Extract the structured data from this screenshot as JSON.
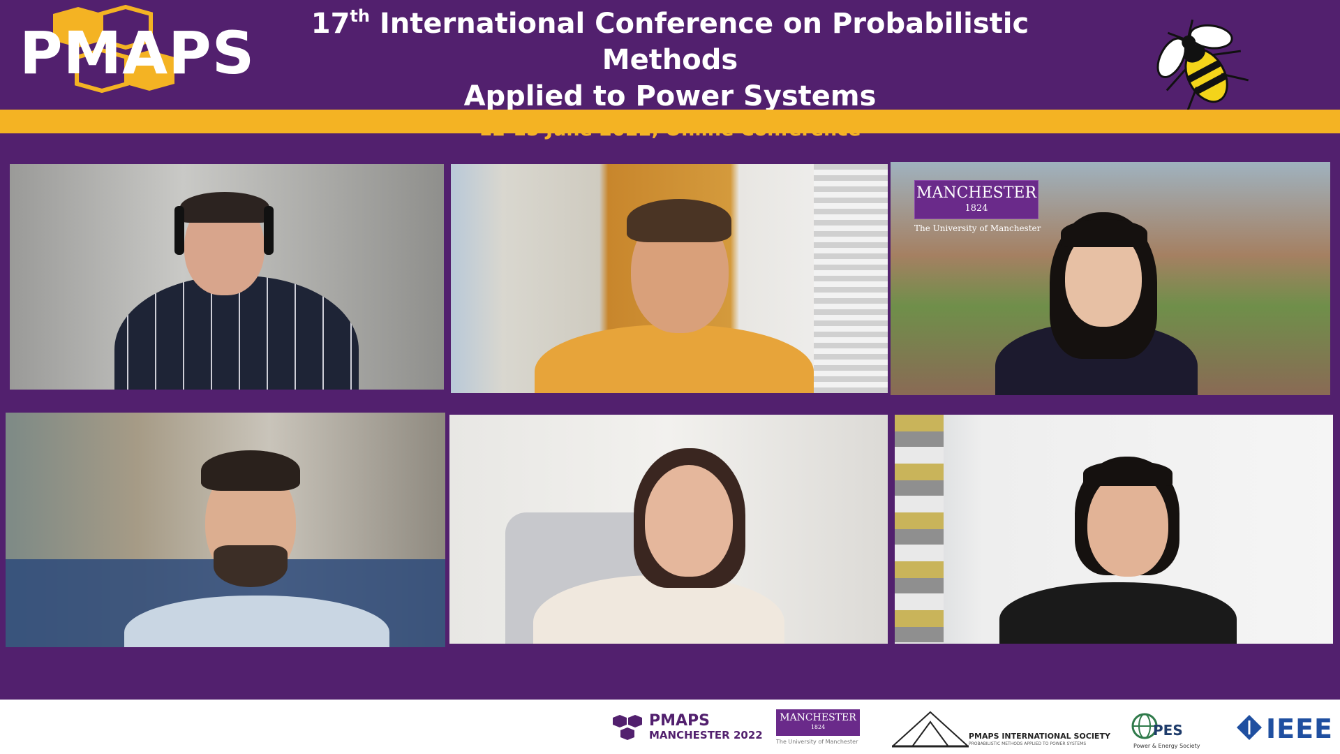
{
  "header": {
    "logo_text": "PMAPS",
    "title_ordinal": "17",
    "title_suffix": "th",
    "title_line1_rest": " International Conference on Probabilistic Methods",
    "title_line2": "Applied to Power Systems",
    "subtitle": "12-15 June 2022, Online Conference"
  },
  "tiles": [
    {
      "id": "participant-1"
    },
    {
      "id": "participant-2"
    },
    {
      "id": "participant-3",
      "badge_name": "MANCHESTER",
      "badge_year": "1824",
      "badge_caption": "The University of Manchester"
    },
    {
      "id": "participant-4"
    },
    {
      "id": "participant-5"
    },
    {
      "id": "participant-6"
    }
  ],
  "footer": {
    "pmaps_name": "PMAPS",
    "pmaps_sub": "MANCHESTER 2022",
    "uom_name": "MANCHESTER",
    "uom_year": "1824",
    "uom_caption": "The University of Manchester",
    "pmaps_int": "PMAPS INTERNATIONAL SOCIETY",
    "pmaps_int_sub": "PROBABILISTIC METHODS APPLIED TO POWER SYSTEMS",
    "pes_name": "PES",
    "pes_caption": "Power & Energy Society",
    "ieee_name": "IEEE"
  },
  "colors": {
    "background_purple": "#52206e",
    "accent_gold": "#f4b323",
    "subtitle_gold": "#f6b426",
    "white": "#ffffff"
  },
  "icons": [
    "pmaps-hexagon-logo",
    "manchester-bee-icon",
    "pmaps-hexagon-small-icon",
    "pmaps-society-logo",
    "ieee-pes-globe-icon",
    "ieee-diamond-icon"
  ]
}
